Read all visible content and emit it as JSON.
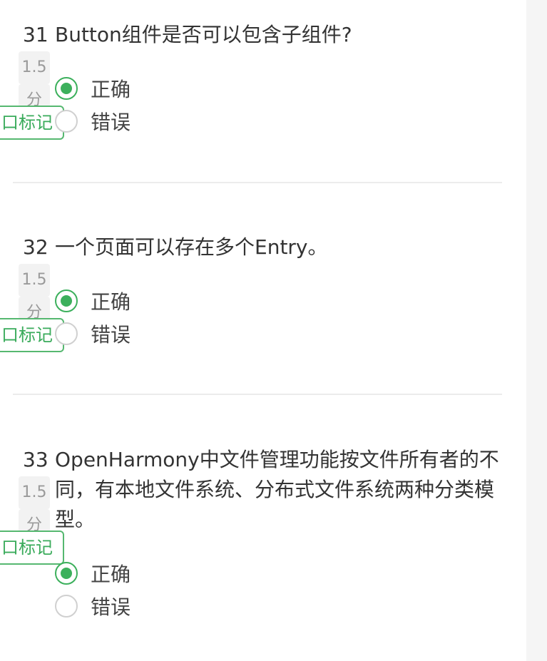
{
  "mark_label": "口标记",
  "score_unit": "分",
  "questions": [
    {
      "number": "31",
      "text": "Button组件是否可以包含子组件?",
      "score": "1.5",
      "options": [
        {
          "label": "正确",
          "selected": true
        },
        {
          "label": "错误",
          "selected": false
        }
      ]
    },
    {
      "number": "32",
      "text": "一个页面可以存在多个Entry。",
      "score": "1.5",
      "options": [
        {
          "label": "正确",
          "selected": true
        },
        {
          "label": "错误",
          "selected": false
        }
      ]
    },
    {
      "number": "33",
      "text": "OpenHarmony中文件管理功能按文件所有者的不同，有本地文件系统、分布式文件系统两种分类模型。",
      "score": "1.5",
      "options": [
        {
          "label": "正确",
          "selected": true
        },
        {
          "label": "错误",
          "selected": false
        }
      ]
    }
  ]
}
